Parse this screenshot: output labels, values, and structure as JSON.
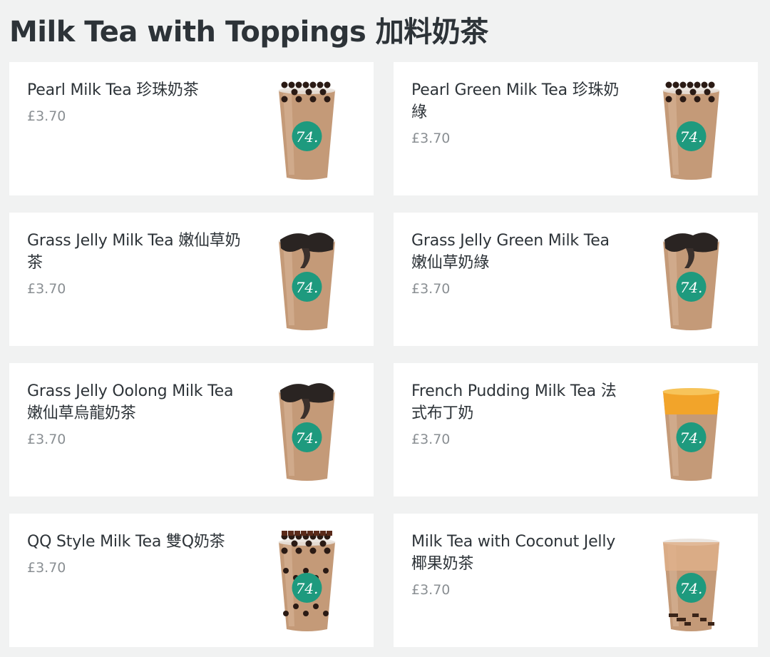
{
  "section": {
    "title": "Milk Tea with Toppings 加料奶茶"
  },
  "colors": {
    "page_bg": "#f1f2f2",
    "card_bg": "#ffffff",
    "text": "#2d3338",
    "price": "#8a8f93",
    "logo_badge": "#1e9a7e",
    "tea": "#c49a78"
  },
  "items": [
    {
      "name": "Pearl Milk Tea 珍珠奶茶",
      "price": "£3.70",
      "topping": "pearls",
      "image_icon": "bubble-tea-cup-icon"
    },
    {
      "name": "Pearl Green Milk Tea 珍珠奶綠",
      "price": "£3.70",
      "topping": "pearls",
      "image_icon": "bubble-tea-cup-icon"
    },
    {
      "name": "Grass Jelly Milk Tea 嫩仙草奶茶",
      "price": "£3.70",
      "topping": "grass-jelly",
      "image_icon": "grass-jelly-cup-icon"
    },
    {
      "name": "Grass Jelly Green Milk Tea 嫩仙草奶綠",
      "price": "£3.70",
      "topping": "grass-jelly",
      "image_icon": "grass-jelly-cup-icon"
    },
    {
      "name": "Grass Jelly Oolong Milk Tea 嫩仙草烏龍奶茶",
      "price": "£3.70",
      "topping": "grass-jelly",
      "image_icon": "grass-jelly-cup-icon"
    },
    {
      "name": "French Pudding Milk Tea 法式布丁奶",
      "price": "£3.70",
      "topping": "pudding",
      "image_icon": "pudding-cup-icon"
    },
    {
      "name": "QQ Style Milk Tea 雙Q奶茶",
      "price": "£3.70",
      "topping": "qq",
      "image_icon": "qq-cup-icon"
    },
    {
      "name": "Milk Tea with Coconut Jelly 椰果奶茶",
      "price": "£3.70",
      "topping": "coconut",
      "image_icon": "coconut-jelly-cup-icon"
    }
  ],
  "logo_text": "74."
}
